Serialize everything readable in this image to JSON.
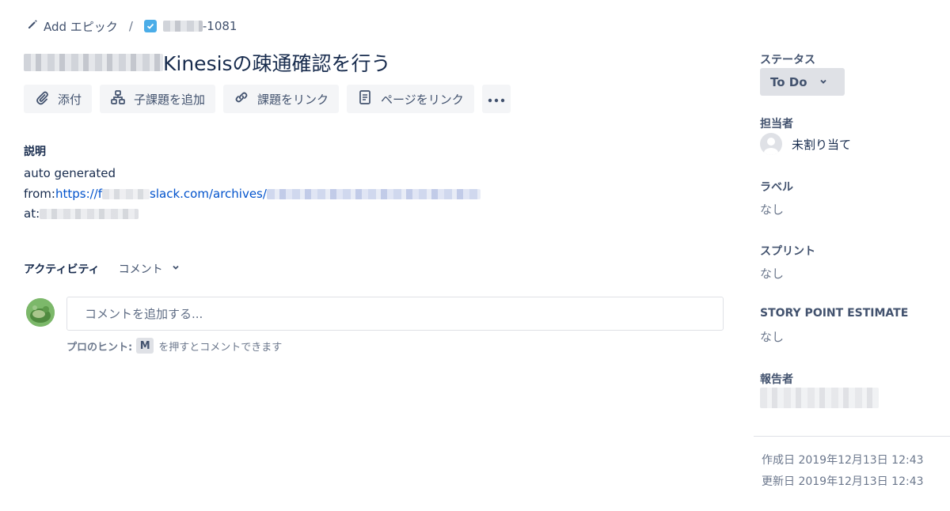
{
  "breadcrumb": {
    "epic_label": "Add エピック",
    "separator": "/",
    "issue_key_suffix": "-1081"
  },
  "issue": {
    "title": "Kinesisの疎通確認を行う"
  },
  "toolbar": {
    "attach": "添付",
    "add_child": "子課題を追加",
    "link_issue": "課題をリンク",
    "link_page": "ページをリンク"
  },
  "description": {
    "heading": "説明",
    "line1": "auto generated",
    "from_label": "from: ",
    "url_prefix": "https://f",
    "url_middle": "slack.com/archives/",
    "at_label": "at:"
  },
  "activity": {
    "label": "アクティビティ",
    "filter": "コメント",
    "comment_placeholder": "コメントを追加する...",
    "hint_label": "プロのヒント:",
    "hint_key": "M",
    "hint_text": "を押すとコメントできます"
  },
  "sidebar": {
    "status_label": "ステータス",
    "status_value": "To Do",
    "assignee_label": "担当者",
    "assignee_value": "未割り当て",
    "labels_label": "ラベル",
    "labels_value": "なし",
    "sprint_label": "スプリント",
    "sprint_value": "なし",
    "story_point_label": "STORY POINT ESTIMATE",
    "story_point_value": "なし",
    "reporter_label": "報告者"
  },
  "dates": {
    "created": "作成日 2019年12月13日 12:43",
    "updated": "更新日 2019年12月13日 12:43"
  },
  "colors": {
    "text": "#172b4d",
    "subtle": "#42526e",
    "link": "#0052cc",
    "button_bg": "#f4f5f7",
    "status_bg": "#dfe1e6",
    "story_icon": "#4bade8"
  }
}
